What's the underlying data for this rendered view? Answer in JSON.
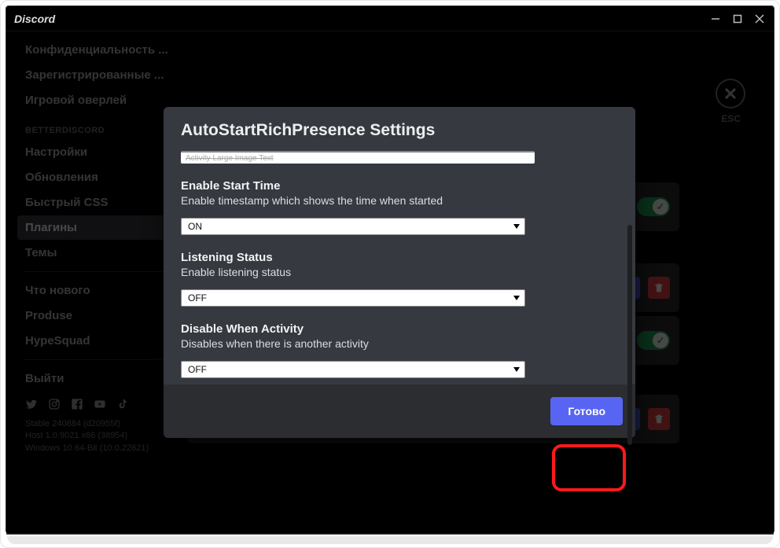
{
  "titlebar": {
    "brand": "Discord"
  },
  "close": {
    "esc": "ESC"
  },
  "sidebar": {
    "items_top": [
      "Конфиденциальность ...",
      "Зарегистрированные ...",
      "Игровой оверлей"
    ],
    "bd_header": "BETTERDISCORD",
    "bd_items": [
      "Настройки",
      "Обновления",
      "Быстрый CSS",
      "Плагины",
      "Темы"
    ],
    "misc_items": [
      "Что нового",
      "Produse",
      "HypeSquad"
    ],
    "logout": "Выйти",
    "build": [
      "Stable 240884 (d20955f)",
      "Host 1.0.9021 x86 (38954)",
      "Windows 10 64-Bit (10.0.22621)"
    ]
  },
  "modal": {
    "title": "AutoStartRichPresence Settings",
    "input_ghost": "Activity Large Image Text",
    "settings": [
      {
        "title": "Enable Start Time",
        "desc": "Enable timestamp which shows the time when started",
        "value": "ON"
      },
      {
        "title": "Listening Status",
        "desc": "Enable listening status",
        "value": "OFF"
      },
      {
        "title": "Disable When Activity",
        "desc": "Disables when there is another activity",
        "value": "OFF"
      }
    ],
    "done": "Готово"
  }
}
